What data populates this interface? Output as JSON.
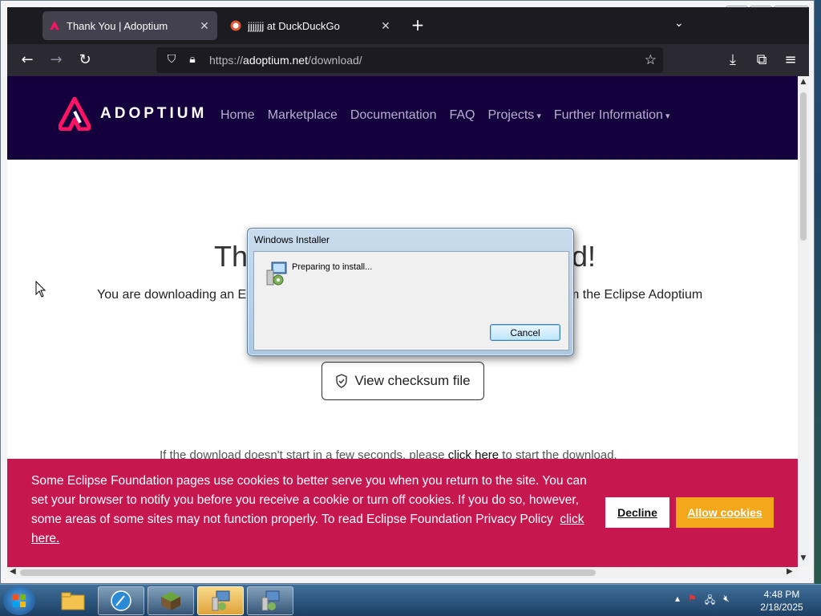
{
  "window": {
    "tabs": [
      {
        "label": "Thank You | Adoptium",
        "active": true,
        "favicon": "adoptium-logo-icon"
      },
      {
        "label": "jjjjjjj at DuckDuckGo",
        "active": false,
        "favicon": "duckduckgo-icon"
      }
    ],
    "controls": {
      "minimize": "—",
      "restore": "▭",
      "close": "✕"
    }
  },
  "navbar": {
    "url_scheme": "https://",
    "url_host": "adoptium.net",
    "url_path": "/download/"
  },
  "site": {
    "brand": "ADOPTIUM",
    "nav": [
      "Home",
      "Marketplace",
      "Documentation",
      "FAQ",
      "Projects",
      "Further Information"
    ],
    "heading_left": "Th",
    "heading_right": "d!",
    "subtext_left": "You are downloading an Ec",
    "subtext_right": "m the Eclipse Adoptium",
    "checksum_label": "View checksum file",
    "download_note_before": "If the download doesn't start in a few seconds, please ",
    "download_note_link": "click here",
    "download_note_after": " to start the download."
  },
  "cookie_banner": {
    "text": "Some Eclipse Foundation pages use cookies to better serve you when you return to the site. You can set your browser to notify you before you receive a cookie or turn off cookies. If you do so, however, some areas of some sites may not function properly. To read Eclipse Foundation Privacy Policy",
    "link": "click here.",
    "decline": "Decline",
    "allow": "Allow cookies",
    "background": "#c7174f",
    "allow_color": "#f2a81a"
  },
  "dialog": {
    "title": "Windows Installer",
    "message": "Preparing to install...",
    "cancel": "Cancel"
  },
  "taskbar": {
    "time": "4:48 PM",
    "date": "2/18/2025"
  },
  "colors": {
    "header_bg": "#14003d",
    "browser_chrome": "#1c1b22"
  }
}
